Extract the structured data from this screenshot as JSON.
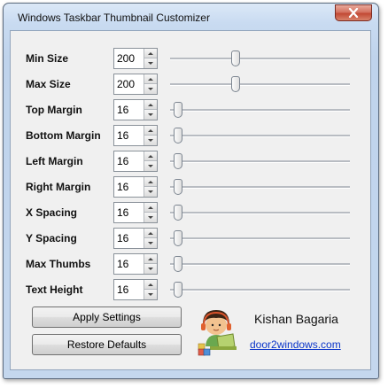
{
  "window": {
    "title": "Windows Taskbar Thumbnail Customizer"
  },
  "settings": [
    {
      "label": "Min Size",
      "value": "200",
      "slider_fraction": 0.36
    },
    {
      "label": "Max Size",
      "value": "200",
      "slider_fraction": 0.36
    },
    {
      "label": "Top Margin",
      "value": "16",
      "slider_fraction": 0.02
    },
    {
      "label": "Bottom Margin",
      "value": "16",
      "slider_fraction": 0.02
    },
    {
      "label": "Left Margin",
      "value": "16",
      "slider_fraction": 0.02
    },
    {
      "label": "Right Margin",
      "value": "16",
      "slider_fraction": 0.02
    },
    {
      "label": "X Spacing",
      "value": "16",
      "slider_fraction": 0.02
    },
    {
      "label": "Y Spacing",
      "value": "16",
      "slider_fraction": 0.02
    },
    {
      "label": "Max Thumbs",
      "value": "16",
      "slider_fraction": 0.02
    },
    {
      "label": "Text Height",
      "value": "16",
      "slider_fraction": 0.02
    }
  ],
  "buttons": {
    "apply": "Apply Settings",
    "restore": "Restore Defaults"
  },
  "credits": {
    "author": "Kishan Bagaria",
    "website": "door2windows.com"
  },
  "icons": {
    "close": "close-icon",
    "avatar": "author-avatar-icon"
  },
  "colors": {
    "link": "#0b35c9",
    "close_button": "#c24a35"
  }
}
